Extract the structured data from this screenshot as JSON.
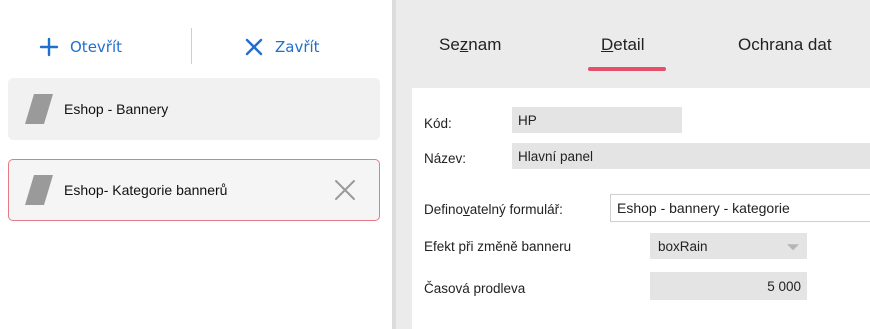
{
  "toolbar": {
    "open_label": "Otevřít",
    "close_label": "Zavřít"
  },
  "list": {
    "items": [
      {
        "label": "Eshop - Bannery",
        "selected": false
      },
      {
        "label": "Eshop- Kategorie bannerů",
        "selected": true
      }
    ]
  },
  "tabs": [
    {
      "label": "Seznam",
      "mnemonic": "z"
    },
    {
      "label": "Detail",
      "mnemonic": "D",
      "active": true
    },
    {
      "label": "Ochrana dat"
    }
  ],
  "form": {
    "kod_label": "Kód:",
    "kod_value": "HP",
    "nazev_label": "Název:",
    "nazev_value": "Hlavní panel",
    "formular_label": "Definovatelný formulář:",
    "formular_value": "Eshop - bannery - kategorie",
    "efekt_label": "Efekt při změně banneru",
    "efekt_value": "boxRain",
    "prodleva_label": "Časová prodleva",
    "prodleva_value": "5 000"
  },
  "colors": {
    "accent_blue": "#1f6fd1",
    "accent_red": "#e2506a",
    "selected_border": "#e57985"
  }
}
